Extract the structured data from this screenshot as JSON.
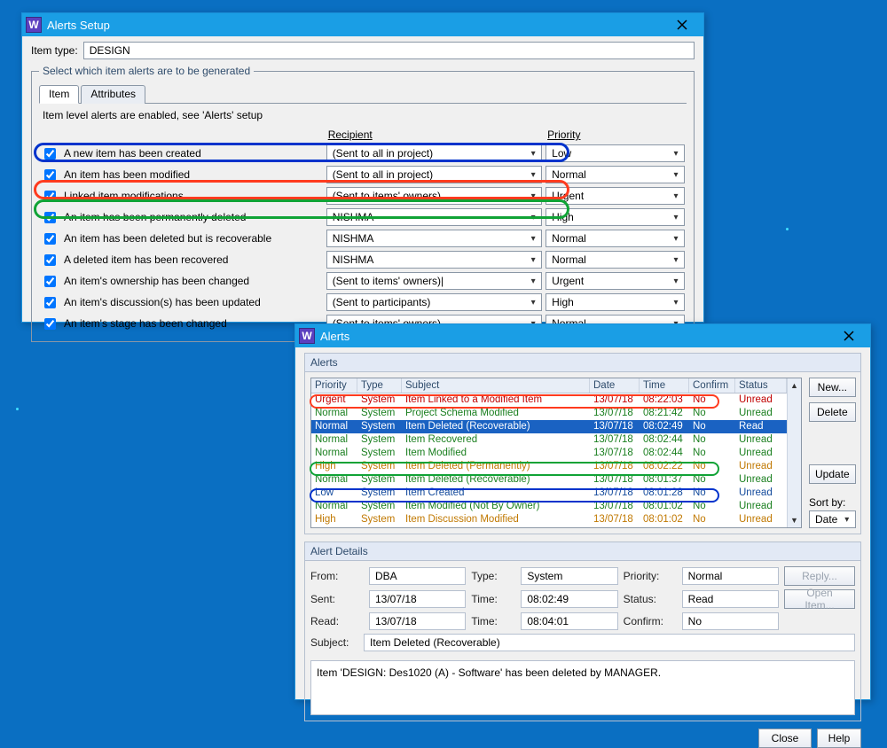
{
  "setup": {
    "title": "Alerts Setup",
    "item_type_label": "Item type:",
    "item_type_value": "DESIGN",
    "group_legend": "Select which item alerts are to be generated",
    "tab_item": "Item",
    "tab_attributes": "Attributes",
    "hint": "Item level alerts are enabled, see 'Alerts' setup",
    "col_recipient": "Recipient",
    "col_priority": "Priority",
    "rows": [
      {
        "label": "A new item has been created",
        "recipient": "(Sent to all in project)",
        "priority": "Low"
      },
      {
        "label": "An item has been modified",
        "recipient": "(Sent to all in project)",
        "priority": "Normal"
      },
      {
        "label": "Linked item modifications",
        "recipient": "(Sent to items' owners)",
        "priority": "Urgent"
      },
      {
        "label": "An item has been permanently deleted",
        "recipient": "NISHMA",
        "priority": "High"
      },
      {
        "label": "An item has been deleted but is recoverable",
        "recipient": "NISHMA",
        "priority": "Normal"
      },
      {
        "label": "A deleted item has been recovered",
        "recipient": "NISHMA",
        "priority": "Normal"
      },
      {
        "label": "An item's ownership has been changed",
        "recipient": "(Sent to items' owners)|",
        "priority": "Urgent"
      },
      {
        "label": "An item's discussion(s) has been updated",
        "recipient": "(Sent to participants)",
        "priority": "High"
      },
      {
        "label": "An item's stage has been changed",
        "recipient": "(Sent to items' owners)",
        "priority": "Normal"
      }
    ]
  },
  "alerts": {
    "title": "Alerts",
    "section_list": "Alerts",
    "columns": {
      "priority": "Priority",
      "type": "Type",
      "subject": "Subject",
      "date": "Date",
      "time": "Time",
      "confirm": "Confirm",
      "status": "Status"
    },
    "rows": [
      {
        "priority": "Urgent",
        "type": "System",
        "subject": "Item Linked to a Modified Item",
        "date": "13/07/18",
        "time": "08:22:03",
        "confirm": "No",
        "status": "Unread",
        "cls": "urgent"
      },
      {
        "priority": "Normal",
        "type": "System",
        "subject": "Project Schema Modified",
        "date": "13/07/18",
        "time": "08:21:42",
        "confirm": "No",
        "status": "Unread",
        "cls": "normal"
      },
      {
        "priority": "Normal",
        "type": "System",
        "subject": "Item Deleted (Recoverable)",
        "date": "13/07/18",
        "time": "08:02:49",
        "confirm": "No",
        "status": "Read",
        "cls": "normal selected"
      },
      {
        "priority": "Normal",
        "type": "System",
        "subject": "Item Recovered",
        "date": "13/07/18",
        "time": "08:02:44",
        "confirm": "No",
        "status": "Unread",
        "cls": "normal"
      },
      {
        "priority": "Normal",
        "type": "System",
        "subject": "Item Modified",
        "date": "13/07/18",
        "time": "08:02:44",
        "confirm": "No",
        "status": "Unread",
        "cls": "normal"
      },
      {
        "priority": "High",
        "type": "System",
        "subject": "Item Deleted (Permanently)",
        "date": "13/07/18",
        "time": "08:02:22",
        "confirm": "No",
        "status": "Unread",
        "cls": "high"
      },
      {
        "priority": "Normal",
        "type": "System",
        "subject": "Item Deleted (Recoverable)",
        "date": "13/07/18",
        "time": "08:01:37",
        "confirm": "No",
        "status": "Unread",
        "cls": "normal"
      },
      {
        "priority": "Low",
        "type": "System",
        "subject": "Item Created",
        "date": "13/07/18",
        "time": "08:01:28",
        "confirm": "No",
        "status": "Unread",
        "cls": "low"
      },
      {
        "priority": "Normal",
        "type": "System",
        "subject": "Item Modified (Not By Owner)",
        "date": "13/07/18",
        "time": "08:01:02",
        "confirm": "No",
        "status": "Unread",
        "cls": "normal"
      },
      {
        "priority": "High",
        "type": "System",
        "subject": "Item Discussion Modified",
        "date": "13/07/18",
        "time": "08:01:02",
        "confirm": "No",
        "status": "Unread",
        "cls": "high"
      }
    ],
    "buttons": {
      "new": "New...",
      "delete": "Delete",
      "update": "Update",
      "reply": "Reply...",
      "open": "Open Item...",
      "close": "Close",
      "help": "Help"
    },
    "sort_label": "Sort by:",
    "sort_value": "Date",
    "section_details": "Alert Details",
    "details": {
      "from_k": "From:",
      "from_v": "DBA",
      "type_k": "Type:",
      "type_v": "System",
      "priority_k": "Priority:",
      "priority_v": "Normal",
      "sent_k": "Sent:",
      "sent_v": "13/07/18",
      "time1_k": "Time:",
      "time1_v": "08:02:49",
      "status_k": "Status:",
      "status_v": "Read",
      "read_k": "Read:",
      "read_v": "13/07/18",
      "time2_k": "Time:",
      "time2_v": "08:04:01",
      "confirm_k": "Confirm:",
      "confirm_v": "No",
      "subject_k": "Subject:",
      "subject_v": "Item Deleted (Recoverable)",
      "body": "Item 'DESIGN: Des1020 (A) - Software' has been deleted by MANAGER."
    }
  }
}
